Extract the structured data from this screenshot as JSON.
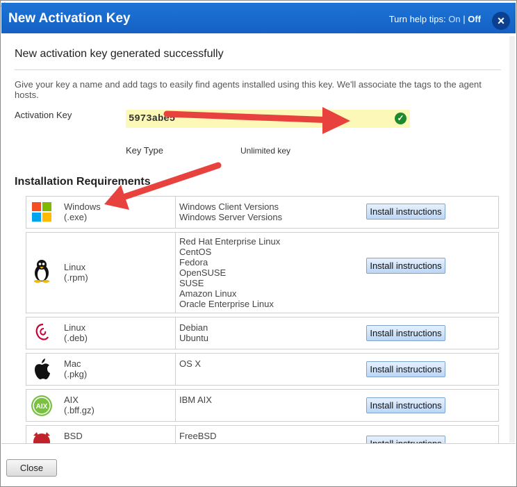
{
  "dialog": {
    "title": "New Activation Key",
    "help_tips_label": "Turn help tips:",
    "help_on": "On",
    "help_sep": "|",
    "help_off": "Off",
    "close_icon": "×"
  },
  "content": {
    "success_message": "New activation key generated successfully",
    "description": "Give your key a name and add tags to easily find agents installed using this key. We'll associate the tags to the agent hosts.",
    "activation_key_label": "Activation Key",
    "activation_key_value": "5973abe5",
    "key_type_label": "Key Type",
    "key_type_value": "Unlimited key",
    "requirements_heading": "Installation Requirements"
  },
  "platforms": [
    {
      "name": "Windows",
      "pkg": "(.exe)",
      "versions": [
        "Windows Client Versions",
        "Windows Server Versions"
      ],
      "button": "Install instructions",
      "icon": "windows-icon"
    },
    {
      "name": "Linux",
      "pkg": "(.rpm)",
      "versions": [
        "Red Hat Enterprise Linux",
        "CentOS",
        "Fedora",
        "OpenSUSE",
        "SUSE",
        "Amazon Linux",
        "Oracle Enterprise Linux"
      ],
      "button": "Install instructions",
      "icon": "tux-icon"
    },
    {
      "name": "Linux",
      "pkg": "(.deb)",
      "versions": [
        "Debian",
        "Ubuntu"
      ],
      "button": "Install instructions",
      "icon": "debian-icon"
    },
    {
      "name": "Mac",
      "pkg": "(.pkg)",
      "versions": [
        "OS X"
      ],
      "button": "Install instructions",
      "icon": "apple-icon"
    },
    {
      "name": "AIX",
      "pkg": "(.bff.gz)",
      "versions": [
        "IBM AIX"
      ],
      "button": "Install instructions",
      "icon": "aix-icon",
      "icon_text": "AIX"
    },
    {
      "name": "BSD",
      "pkg": "",
      "versions": [
        "FreeBSD"
      ],
      "button": "Install instructions",
      "icon": "bsd-icon"
    }
  ],
  "footer": {
    "close_label": "Close"
  },
  "colors": {
    "titlebar": "#1560c4",
    "key_highlight": "#fbf8b8",
    "arrow": "#e8423f"
  }
}
